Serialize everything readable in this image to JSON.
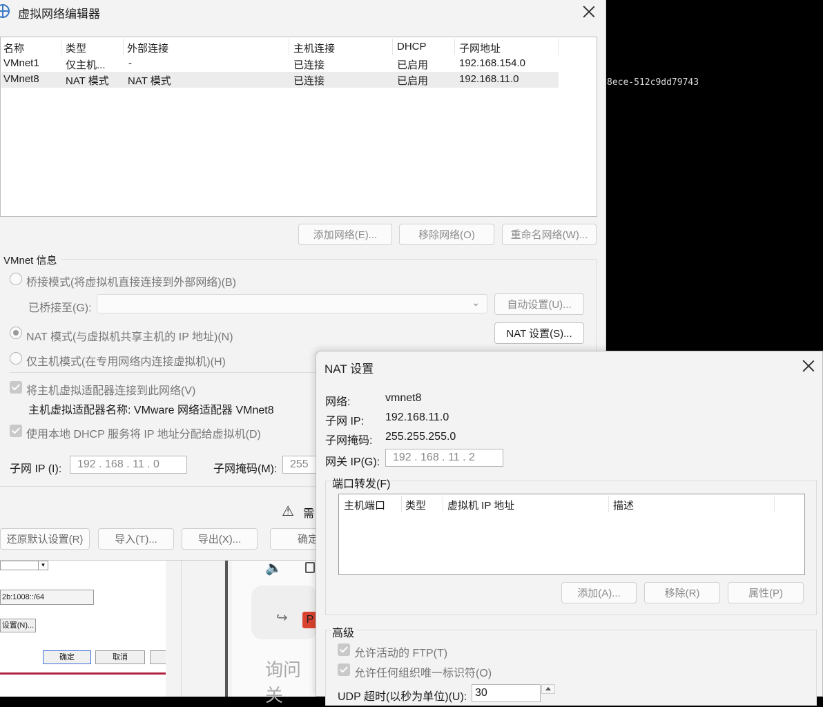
{
  "terminal": {
    "text": "8ece-512c9dd79743"
  },
  "vne": {
    "title": "虚拟网络编辑器",
    "table": {
      "headers": [
        "名称",
        "类型",
        "外部连接",
        "主机连接",
        "DHCP",
        "子网地址"
      ],
      "rows": [
        [
          "VMnet1",
          "仅主机...",
          "-",
          "已连接",
          "已启用",
          "192.168.154.0"
        ],
        [
          "VMnet8",
          "NAT 模式",
          "NAT 模式",
          "已连接",
          "已启用",
          "192.168.11.0"
        ]
      ]
    },
    "buttons": {
      "add": "添加网络(E)...",
      "remove": "移除网络(O)",
      "rename": "重命名网络(W)..."
    },
    "info_title": "VMnet 信息",
    "bridged": "桥接模式(将虚拟机直接连接到外部网络)(B)",
    "bridged_to": "已桥接至(G):",
    "auto_set": "自动设置(U)...",
    "nat_mode": "NAT 模式(与虚拟机共享主机的 IP 地址)(N)",
    "nat_settings": "NAT 设置(S)...",
    "host_only": "仅主机模式(在专用网络内连接虚拟机)(H)",
    "connect_adapter": "将主机虚拟适配器连接到此网络(V)",
    "adapter_name": "主机虚拟适配器名称: VMware 网络适配器 VMnet8",
    "use_dhcp": "使用本地 DHCP 服务将 IP 地址分配给虚拟机(D)",
    "subnet_ip_label": "子网 IP (I):",
    "subnet_ip_value": "192 . 168 . 11  .  0",
    "subnet_mask_label": "子网掩码(M):",
    "subnet_mask_value": "255",
    "warning": "需",
    "restore": "还原默认设置(R)",
    "import": "导入(T)...",
    "export": "导出(X)...",
    "ok": "确定"
  },
  "bg": {
    "ipv6": "2b:1008::/64",
    "settings": "设置(N)...",
    "ok": "确定",
    "cancel": "取消",
    "ask": "询问关",
    "p": "P"
  },
  "nat": {
    "title": "NAT 设置",
    "network_label": "网络:",
    "network_value": "vmnet8",
    "subnet_ip_label": "子网 IP:",
    "subnet_ip_value": "192.168.11.0",
    "subnet_mask_label": "子网掩码:",
    "subnet_mask_value": "255.255.255.0",
    "gateway_label": "网关 IP(G):",
    "gateway_value": "192 . 168 . 11  .  2",
    "port_forward": "端口转发(F)",
    "pf_headers": [
      "主机端口",
      "类型",
      "虚拟机 IP 地址",
      "描述"
    ],
    "add": "添加(A)...",
    "remove": "移除(R)",
    "properties": "属性(P)",
    "advanced": "高级",
    "allow_ftp": "允许活动的 FTP(T)",
    "allow_oui": "允许任何组织唯一标识符(O)",
    "udp_label": "UDP 超时(以秒为单位)(U):",
    "udp_value": "30"
  }
}
